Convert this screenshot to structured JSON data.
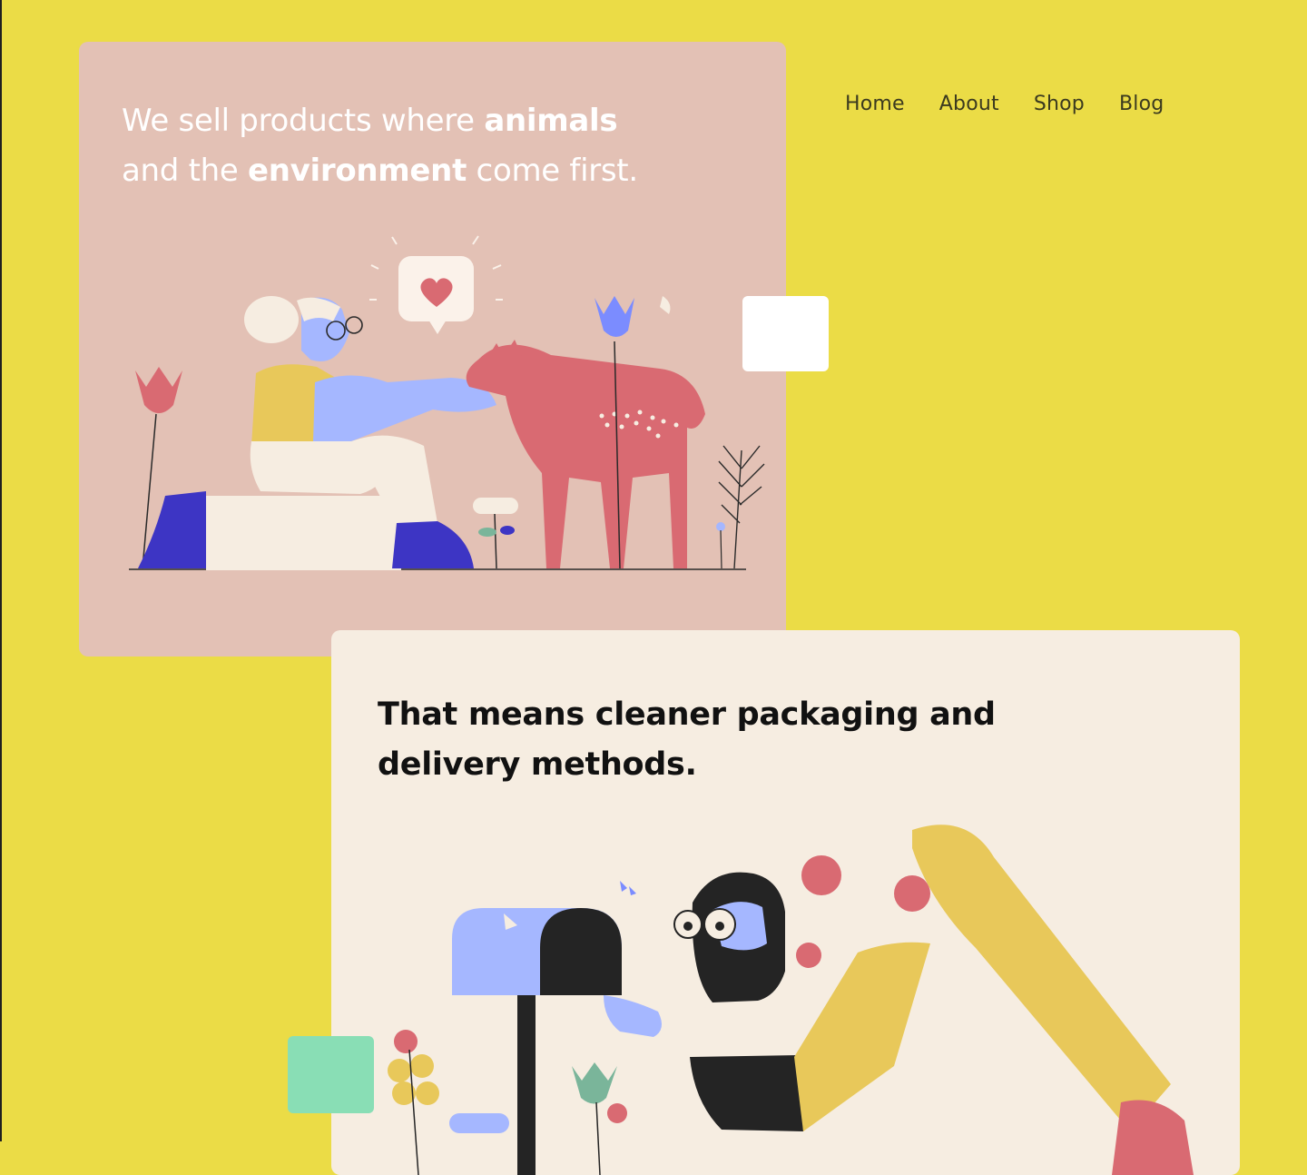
{
  "nav": {
    "items": [
      {
        "label": "Home"
      },
      {
        "label": "About"
      },
      {
        "label": "Shop"
      },
      {
        "label": "Blog"
      }
    ]
  },
  "hero": {
    "line1_plain": "We sell products where ",
    "line1_bold": "animals",
    "line2_plain_a": "and the ",
    "line2_bold": "environment",
    "line2_plain_b": " come first."
  },
  "packaging": {
    "headline": "That means cleaner packaging and delivery methods."
  },
  "colors": {
    "background": "#ebdc46",
    "pink_card": "#e3c1b5",
    "cream_card": "#f6ede1",
    "mint_square": "#89deb5"
  },
  "illustrations": {
    "hero": "woman-petting-deer-illustration",
    "packaging": "woman-at-mailbox-illustration"
  }
}
